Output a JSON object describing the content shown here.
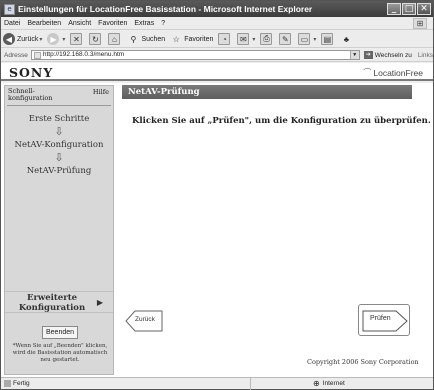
{
  "window": {
    "title": "Einstellungen für LocationFree Basisstation - Microsoft Internet Explorer",
    "min_glyph": "_",
    "max_glyph": "□",
    "close_glyph": "✕"
  },
  "menubar": [
    "Datei",
    "Bearbeiten",
    "Ansicht",
    "Favoriten",
    "Extras",
    "?"
  ],
  "toolbar": {
    "back_label": "Zurück",
    "search_label": "Suchen",
    "favorites_label": "Favoriten"
  },
  "address": {
    "label": "Adresse",
    "url": "http://192.168.0.3/menu.htm",
    "go_label": "Wechseln zu",
    "links_label": "Links"
  },
  "brand": {
    "sony": "SONY",
    "locationfree": "LocationFree"
  },
  "sidebar": {
    "quick_config": "Schnell-konfiguration",
    "help": "Hilfe",
    "steps": [
      "Erste Schritte",
      "NetAV-Konfiguration",
      "NetAV-Prüfung"
    ],
    "arrow_glyph": "⇩",
    "advanced": "Erweiterte Konfiguration",
    "advanced_arrow": "▶",
    "end_button": "Beenden",
    "note": "*Wenn Sie auf „Beenden\" klicken, wird die Basisstation automatisch neu gestartet."
  },
  "main": {
    "header": "NetAV-Prüfung",
    "message": "Klicken Sie auf „Prüfen\", um die Konfiguration zu überprüfen.",
    "back_button": "Zurück",
    "check_button": "Prüfen",
    "copyright": "Copyright 2006 Sony Corporation"
  },
  "statusbar": {
    "status": "Fertig",
    "zone": "Internet"
  }
}
